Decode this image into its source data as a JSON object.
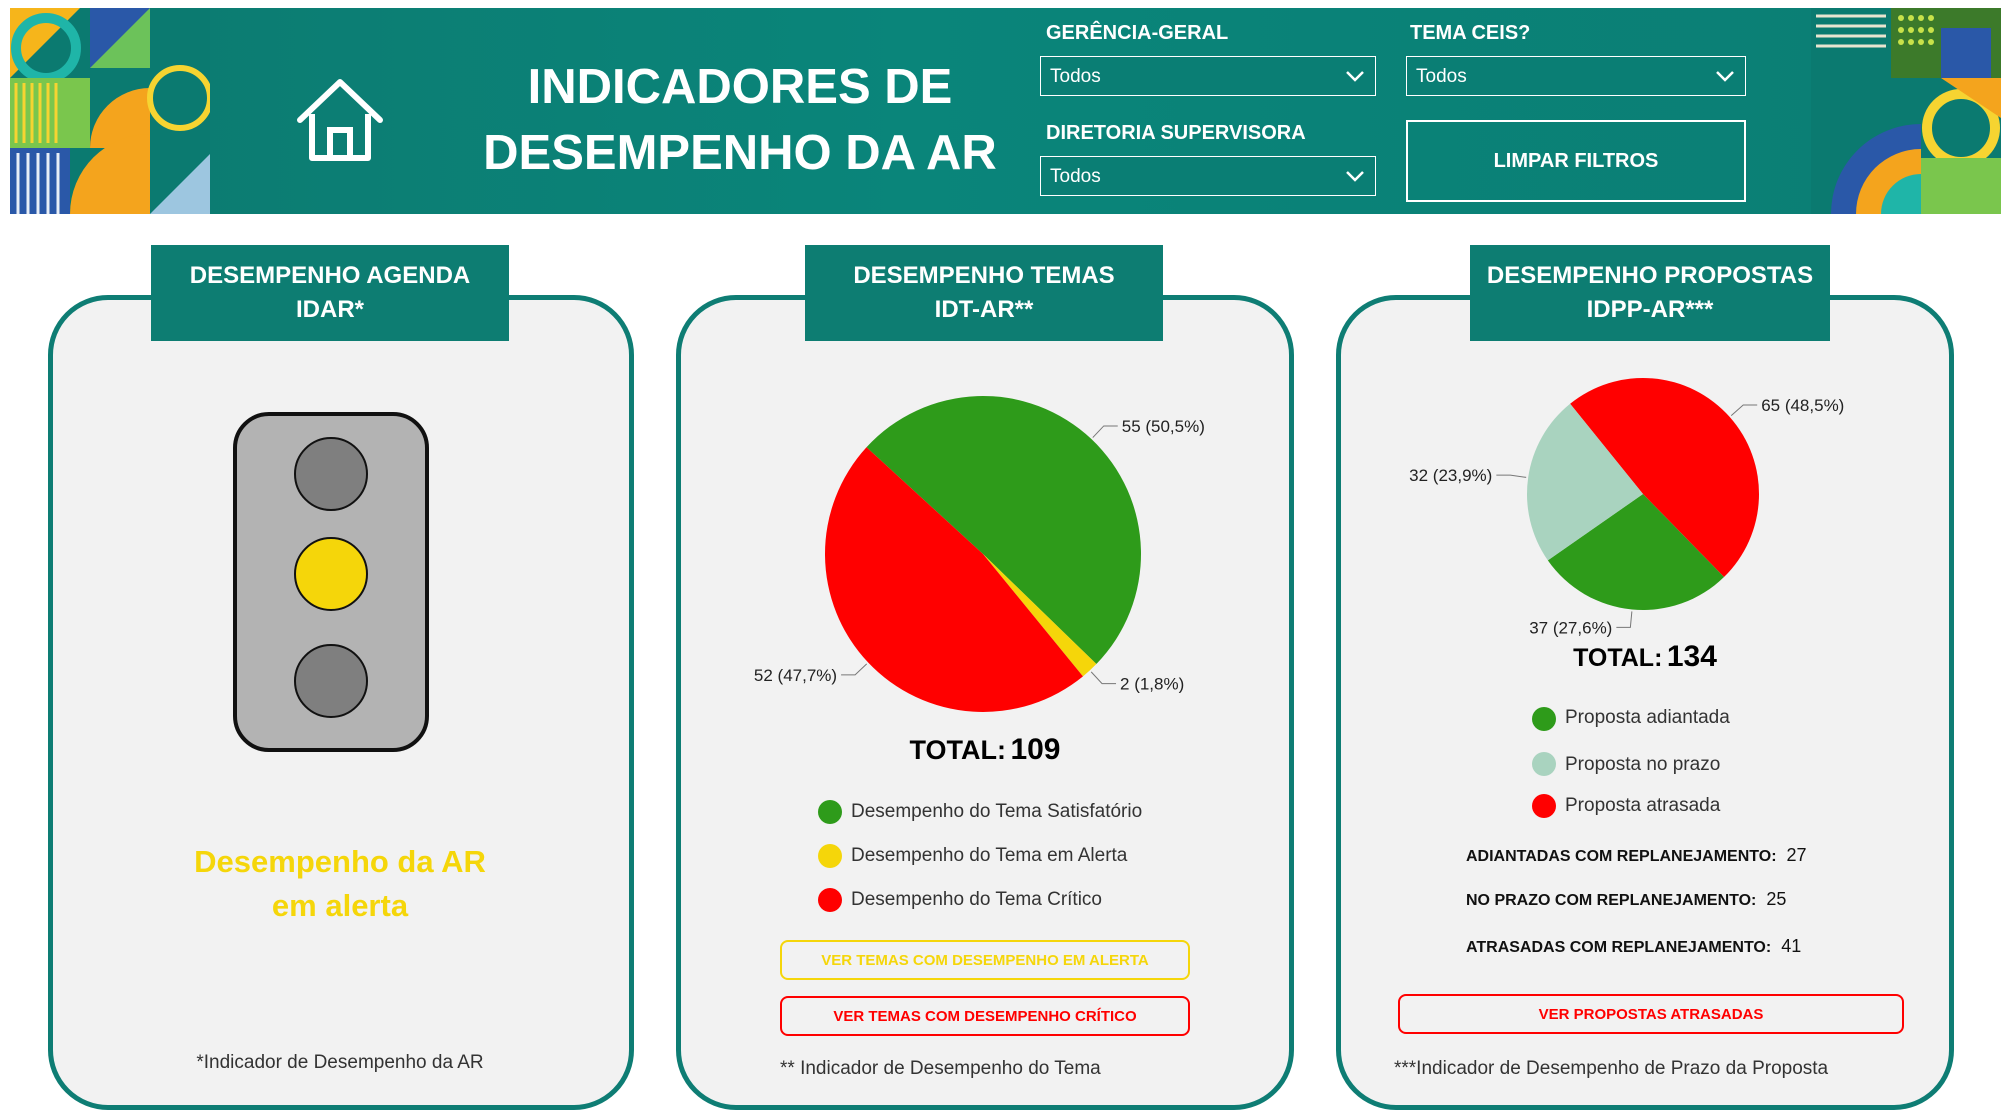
{
  "header": {
    "title_line1": "INDICADORES DE",
    "title_line2": "DESEMPENHO DA AR",
    "filters": {
      "gerencia_label": "GERÊNCIA-GERAL",
      "gerencia_value": "Todos",
      "tema_label": "TEMA CEIS?",
      "tema_value": "Todos",
      "diretoria_label": "DIRETORIA SUPERVISORA",
      "diretoria_value": "Todos"
    },
    "clear_label": "LIMPAR FILTROS"
  },
  "colors": {
    "teal": "#0d7d72",
    "green": "#2e9b1a",
    "yellow": "#f5d60a",
    "red": "#ff0000",
    "light_green": "#a9d3bf"
  },
  "agenda": {
    "tab_line1": "DESEMPENHO AGENDA",
    "tab_line2": "IDAR*",
    "status_line1": "Desempenho da AR",
    "status_line2": "em alerta",
    "footnote": "*Indicador de Desempenho da AR",
    "active_light": "yellow"
  },
  "temas": {
    "tab_line1": "DESEMPENHO TEMAS",
    "tab_line2": "IDT-AR**",
    "total_label": "TOTAL:",
    "total_value": "109",
    "legend": [
      "Desempenho do Tema Satisfatório",
      "Desempenho do Tema em Alerta",
      "Desempenho do Tema Crítico"
    ],
    "btn_alerta": "VER TEMAS COM DESEMPENHO EM ALERTA",
    "btn_critico": "VER TEMAS COM DESEMPENHO CRÍTICO",
    "footnote": "** Indicador de Desempenho do Tema"
  },
  "propostas": {
    "tab_line1": "DESEMPENHO PROPOSTAS",
    "tab_line2": "IDPP-AR***",
    "total_label": "TOTAL:",
    "total_value": "134",
    "legend": [
      "Proposta adiantada",
      "Proposta no prazo",
      "Proposta atrasada"
    ],
    "stats": [
      {
        "label": "ADIANTADAS COM REPLANEJAMENTO:",
        "value": "27"
      },
      {
        "label": "NO PRAZO COM REPLANEJAMENTO:",
        "value": "25"
      },
      {
        "label": "ATRASADAS COM REPLANEJAMENTO:",
        "value": "41"
      }
    ],
    "btn_atrasadas": "VER PROPOSTAS ATRASADAS",
    "footnote": "***Indicador de Desempenho de Prazo da Proposta"
  },
  "chart_data": [
    {
      "type": "pie",
      "categories": [
        "Desempenho do Tema Satisfatório",
        "Desempenho do Tema em Alerta",
        "Desempenho do Tema Crítico"
      ],
      "values": [
        55,
        2,
        52
      ],
      "labels": [
        "55 (50,5%)",
        "2 (1,8%)",
        "52 (47,7%)"
      ],
      "colors": [
        "#2e9b1a",
        "#f5d60a",
        "#ff0000"
      ]
    },
    {
      "type": "pie",
      "categories": [
        "Proposta atrasada",
        "Proposta adiantada",
        "Proposta no prazo"
      ],
      "values": [
        65,
        37,
        32
      ],
      "labels": [
        "65 (48,5%)",
        "37 (27,6%)",
        "32 (23,9%)"
      ],
      "colors": [
        "#ff0000",
        "#2e9b1a",
        "#a9d3bf"
      ]
    }
  ]
}
